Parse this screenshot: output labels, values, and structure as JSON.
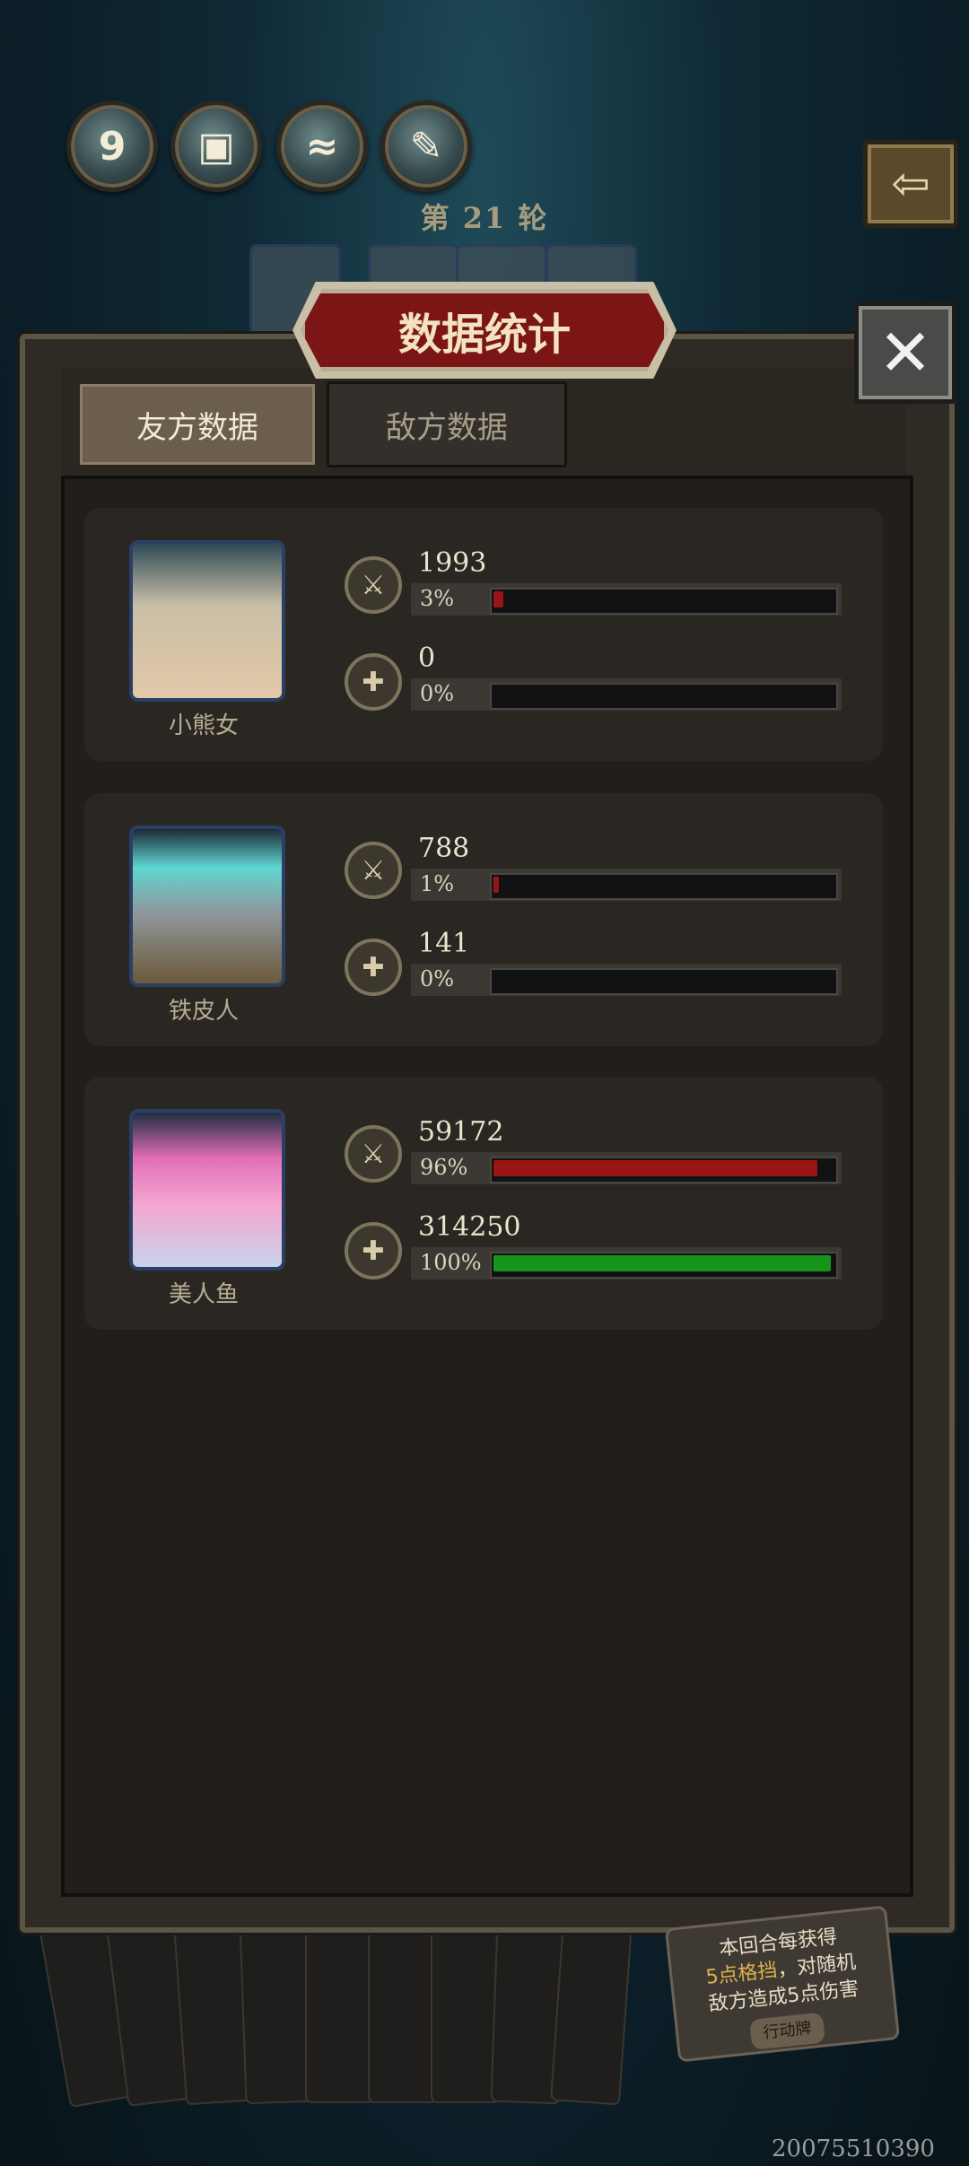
{
  "hud": {
    "icons": [
      {
        "name": "counter-icon",
        "text": "9"
      },
      {
        "name": "chest-icon",
        "text": ""
      },
      {
        "name": "water-icon",
        "text": ""
      },
      {
        "name": "scroll-icon",
        "text": ""
      }
    ],
    "round_label": "第 21 轮"
  },
  "dialog": {
    "title": "数据统计",
    "tabs": [
      {
        "label": "友方数据",
        "active": true
      },
      {
        "label": "敌方数据",
        "active": false
      }
    ]
  },
  "characters": [
    {
      "name": "小熊女",
      "damage": {
        "value": "1993",
        "percent_label": "3%",
        "fraction": 0.03
      },
      "heal": {
        "value": "0",
        "percent_label": "0%",
        "fraction": 0.0
      }
    },
    {
      "name": "铁皮人",
      "damage": {
        "value": "788",
        "percent_label": "1%",
        "fraction": 0.01
      },
      "heal": {
        "value": "141",
        "percent_label": "0%",
        "fraction": 0.0
      }
    },
    {
      "name": "美人鱼",
      "damage": {
        "value": "59172",
        "percent_label": "96%",
        "fraction": 0.96
      },
      "heal": {
        "value": "314250",
        "percent_label": "100%",
        "fraction": 1.0
      }
    }
  ],
  "action_card": {
    "text_a": "本回合每获得",
    "text_b_hl": "5点格挡",
    "text_b": "，对随机",
    "text_c": "敌方造成5点伤害",
    "tag": "行动牌"
  },
  "watermark": "20075510390",
  "colors": {
    "damage_bar": "#9b1414",
    "heal_bar": "#17941a",
    "title_banner": "#7c1616"
  }
}
